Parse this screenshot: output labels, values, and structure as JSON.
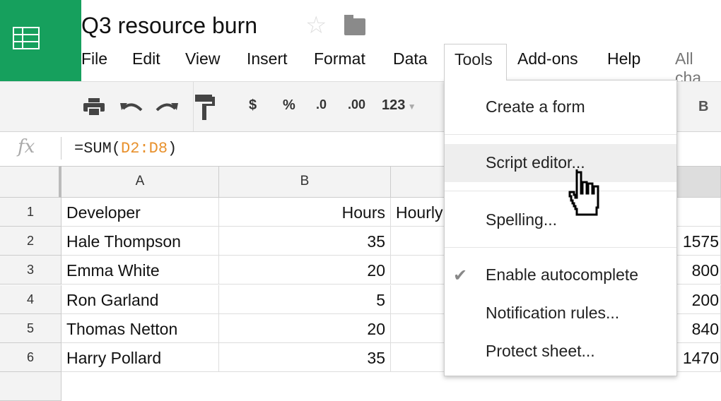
{
  "app": {
    "title": "Q3 resource burn",
    "logo_icon": "sheets-grid-icon",
    "star_icon": "star-outline-icon",
    "folder_icon": "folder-icon",
    "accent": "#16a05d"
  },
  "menu": [
    "File",
    "Edit",
    "View",
    "Insert",
    "Format",
    "Data",
    "Tools",
    "Add-ons",
    "Help"
  ],
  "save_status": "All cha",
  "toolbar": {
    "icons": [
      "print-icon",
      "undo-icon",
      "redo-icon",
      "paint-format-icon"
    ],
    "currency": "$",
    "percent": "%",
    "dec_less": ".0",
    "dec_more": ".00",
    "number_format": "123",
    "bold": "B"
  },
  "formula_bar": {
    "fx": "fx",
    "prefix": "=SUM(",
    "ref": "D2:D8",
    "suffix": ")"
  },
  "columns": [
    "A",
    "B"
  ],
  "rows": [
    {
      "n": "1",
      "a": "Developer",
      "b": "Hours",
      "c": "Hourly",
      "d": ""
    },
    {
      "n": "2",
      "a": "Hale Thompson",
      "b": "35",
      "c": "",
      "d": "1575"
    },
    {
      "n": "3",
      "a": "Emma White",
      "b": "20",
      "c": "",
      "d": "800"
    },
    {
      "n": "4",
      "a": "Ron Garland",
      "b": "5",
      "c": "",
      "d": "200"
    },
    {
      "n": "5",
      "a": "Thomas Netton",
      "b": "20",
      "c": "",
      "d": "840"
    },
    {
      "n": "6",
      "a": "Harry Pollard",
      "b": "35",
      "c": "",
      "d": "1470"
    }
  ],
  "tools_menu": {
    "items": [
      "Create a form",
      "Script editor...",
      "Spelling...",
      "Enable autocomplete",
      "Notification rules...",
      "Protect sheet..."
    ],
    "highlighted": "Script editor...",
    "checked": "Enable autocomplete"
  }
}
